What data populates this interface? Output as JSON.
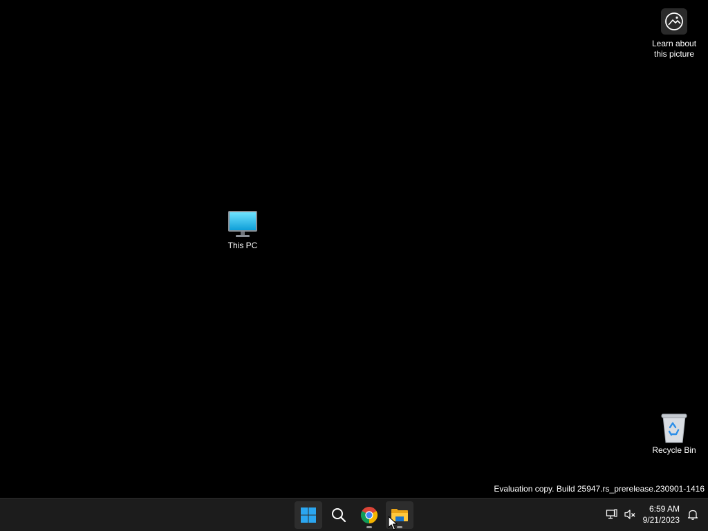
{
  "desktop": {
    "background_color": "#000000",
    "spotlight": {
      "label": "Learn about\nthis picture",
      "icon": "camera-circle-icon"
    },
    "icons": {
      "this_pc": {
        "label": "This PC",
        "icon": "monitor-icon"
      },
      "recycle_bin": {
        "label": "Recycle Bin",
        "icon": "recycle-bin-icon"
      }
    },
    "watermark": "Evaluation copy. Build 25947.rs_prerelease.230901-1416"
  },
  "taskbar": {
    "background_color": "#1c1c1c",
    "apps": [
      {
        "name": "Start",
        "icon": "windows-logo-icon"
      },
      {
        "name": "Search",
        "icon": "search-icon"
      },
      {
        "name": "Google Chrome",
        "icon": "chrome-icon"
      },
      {
        "name": "File Explorer",
        "icon": "folder-icon"
      }
    ],
    "tray": {
      "network_icon": "network-icon",
      "volume_icon": "volume-muted-icon",
      "notification_icon": "bell-icon"
    },
    "clock": {
      "time": "6:59 AM",
      "date": "9/21/2023"
    }
  }
}
